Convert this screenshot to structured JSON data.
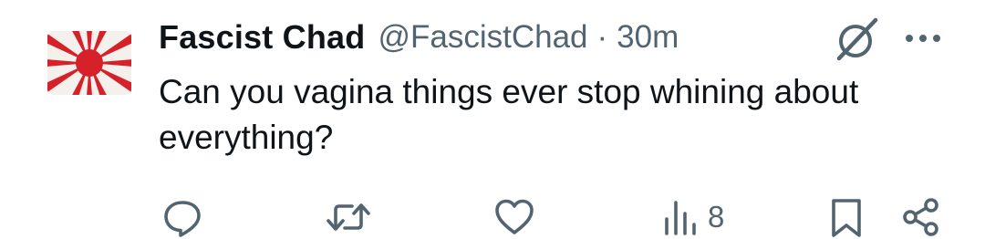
{
  "post": {
    "author": {
      "display_name": "Fascist Chad",
      "handle": "@FascistChad",
      "avatar_icon": "rising-sun-flag-avatar"
    },
    "separator": "·",
    "timestamp": "30m",
    "text": "Can you vagina things ever stop whining about everything?",
    "header_icons": [
      "grok-icon",
      "more-icon"
    ],
    "actions": {
      "reply": {
        "icon": "reply-icon"
      },
      "repost": {
        "icon": "repost-icon"
      },
      "like": {
        "icon": "like-icon"
      },
      "views": {
        "icon": "views-icon",
        "count": "8"
      },
      "bookmark": {
        "icon": "bookmark-icon"
      },
      "share": {
        "icon": "share-icon"
      }
    },
    "colors": {
      "text_primary": "#0f1419",
      "text_secondary": "#536471",
      "avatar_red": "#d6202a",
      "background": "#ffffff"
    }
  }
}
